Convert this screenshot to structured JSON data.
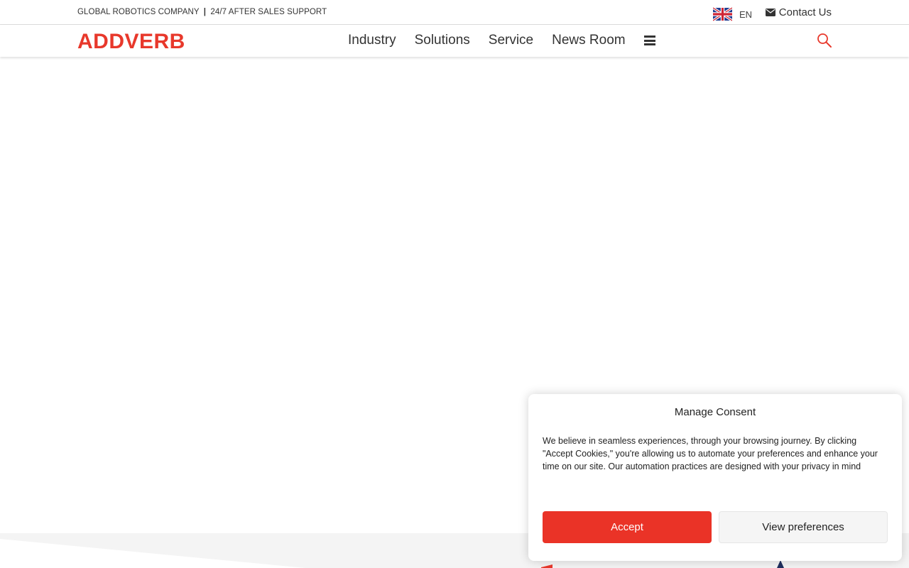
{
  "topbar": {
    "tagline_left": "GLOBAL ROBOTICS COMPANY",
    "tagline_separator": "|",
    "tagline_right": "24/7 AFTER SALES SUPPORT",
    "language": {
      "flag_icon": "uk-flag-icon",
      "code": "EN"
    },
    "contact": {
      "icon": "envelope-icon",
      "label": "Contact Us"
    }
  },
  "header": {
    "logo_text": "ADDVERB",
    "nav": [
      "Industry",
      "Solutions",
      "Service",
      "News Room"
    ],
    "menu_icon": "hamburger-icon",
    "search_icon": "search-icon"
  },
  "consent": {
    "title": "Manage Consent",
    "text": "We believe in seamless experiences, through your browsing journey. By clicking \"Accept Cookies,\" you're allowing us to automate your preferences and enhance your time on our site. Our automation practices are designed with your privacy in mind",
    "accept_label": "Accept",
    "preferences_label": "View preferences"
  },
  "colors": {
    "brand_red": "#e8382b",
    "accept_button": "#ea3327",
    "navy": "#1f2f5e"
  }
}
